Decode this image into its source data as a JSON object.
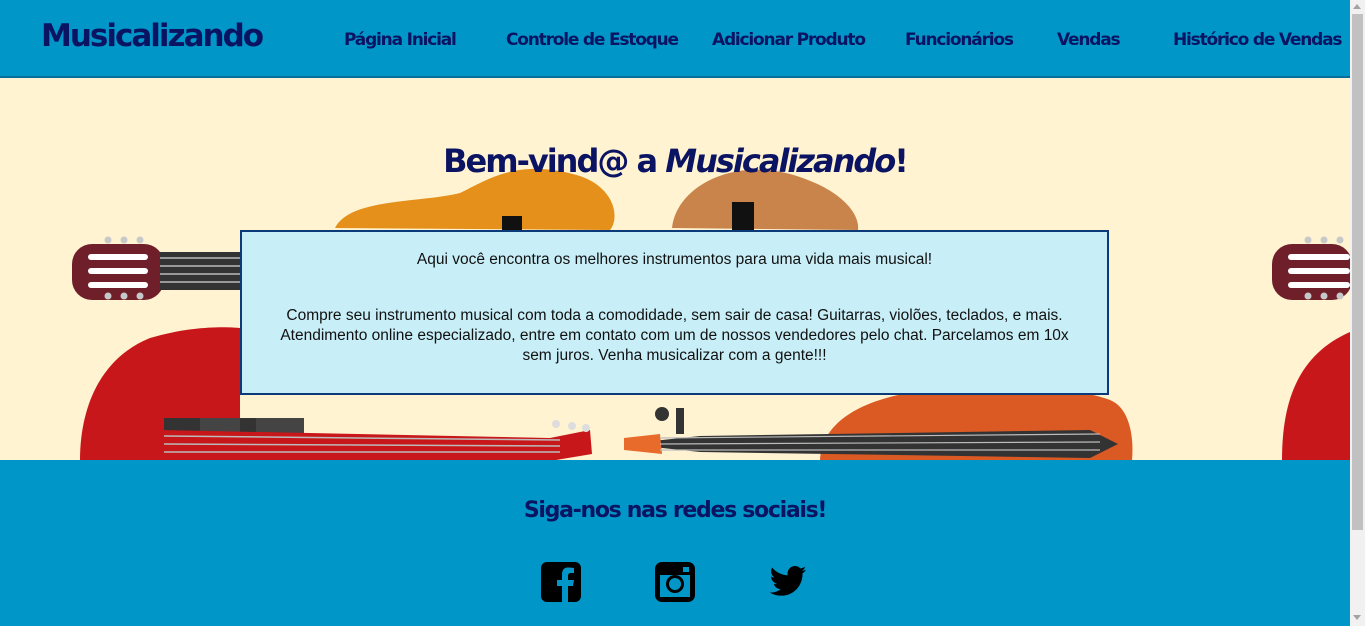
{
  "header": {
    "logo": "Musicalizando",
    "nav": [
      {
        "label": "Página Inicial"
      },
      {
        "label": "Controle de Estoque"
      },
      {
        "label": "Adicionar Produto"
      },
      {
        "label": "Funcionários"
      },
      {
        "label": "Vendas"
      },
      {
        "label": "Histórico de Vendas"
      }
    ]
  },
  "hero": {
    "welcome_prefix": "Bem-vind@ a ",
    "welcome_brand": "Musicalizando",
    "welcome_suffix": "!",
    "intro": "Aqui você encontra os melhores instrumentos para uma vida mais musical!",
    "description": "Compre seu instrumento musical com toda a comodidade, sem sair de casa! Guitarras, violões, teclados, e mais. Atendimento online especializado, entre em contato com um de nossos vendedores pelo chat. Parcelamos em 10x sem juros. Venha musicalizar com a gente!!!"
  },
  "footer": {
    "title": "Siga-nos nas redes sociais!",
    "social": [
      {
        "icon": "facebook-icon"
      },
      {
        "icon": "instagram-icon"
      },
      {
        "icon": "twitter-icon"
      }
    ]
  },
  "colors": {
    "header_bg": "#0096c7",
    "brand_text": "#0b1363",
    "hero_bg": "#fff3d1",
    "box_bg": "#c8eef7",
    "box_border": "#0b3a7a"
  }
}
